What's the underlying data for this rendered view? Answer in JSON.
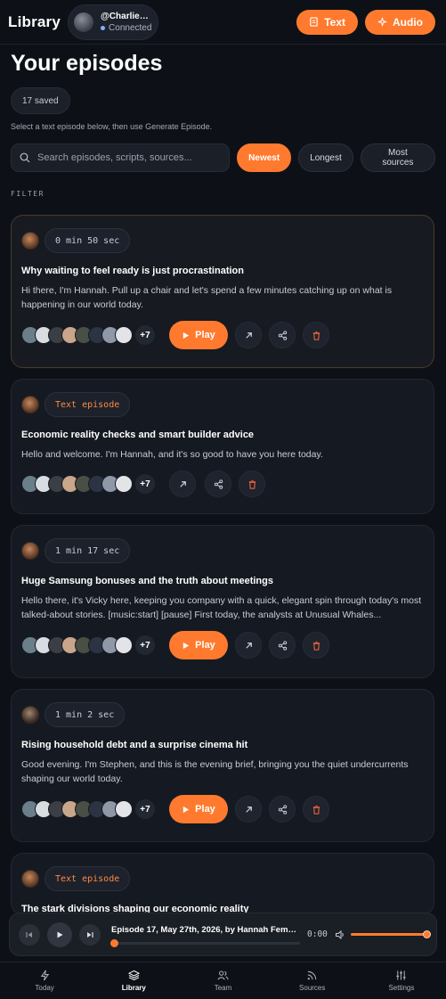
{
  "header": {
    "app_title": "Library",
    "account_handle": "@CharlieMa...",
    "account_status": "Connected",
    "text_button": "Text",
    "audio_button": "Audio"
  },
  "main": {
    "title": "Your episodes",
    "saved_count": "17 saved",
    "hint": "Select a text episode below, then use Generate Episode.",
    "search_placeholder": "Search episodes, scripts, sources...",
    "sort_options": [
      "Newest",
      "Longest",
      "Most sources"
    ],
    "active_sort": "Newest",
    "filter_label": "FILTER"
  },
  "episodes": [
    {
      "tag": "0 min 50 sec",
      "title": "Why waiting to feel ready is just procrastination",
      "desc": "Hi there, I'm Hannah. Pull up a chair and let's spend a few minutes catching up on what is happening in our world today.",
      "more_sources": "+7",
      "play_label": "Play"
    },
    {
      "tag": "Text episode",
      "title": "Economic reality checks and smart builder advice",
      "desc": "Hello and welcome. I'm Hannah, and it's so good to have you here today.",
      "more_sources": "+7"
    },
    {
      "tag": "1 min 17 sec",
      "title": "Huge Samsung bonuses and the truth about meetings",
      "desc": "Hello there, it's Vicky here, keeping you company with a quick, elegant spin through today's most talked-about stories. [music:start] [pause] First today, the analysts at Unusual Whales...",
      "more_sources": "+7",
      "play_label": "Play"
    },
    {
      "tag": "1 min 2 sec",
      "title": "Rising household debt and a surprise cinema hit",
      "desc": "Good evening. I'm Stephen, and this is the evening brief, bringing you the quiet undercurrents shaping our world today.",
      "more_sources": "+7",
      "play_label": "Play"
    },
    {
      "tag": "Text episode",
      "title": "The stark divisions shaping our economic reality"
    }
  ],
  "player": {
    "track_title": "Episode 17, May 27th, 2026, by Hannah Female ...",
    "time": "0:00",
    "progress": 0,
    "volume": 1
  },
  "nav": [
    {
      "label": "Today",
      "icon": "bolt-icon"
    },
    {
      "label": "Library",
      "icon": "layers-icon"
    },
    {
      "label": "Team",
      "icon": "users-icon"
    },
    {
      "label": "Sources",
      "icon": "rss-icon"
    },
    {
      "label": "Settings",
      "icon": "sliders-icon"
    }
  ],
  "active_nav": "Library",
  "colors": {
    "accent": "#ff7a2e",
    "background": "#0d1117",
    "card": "#151a22"
  }
}
